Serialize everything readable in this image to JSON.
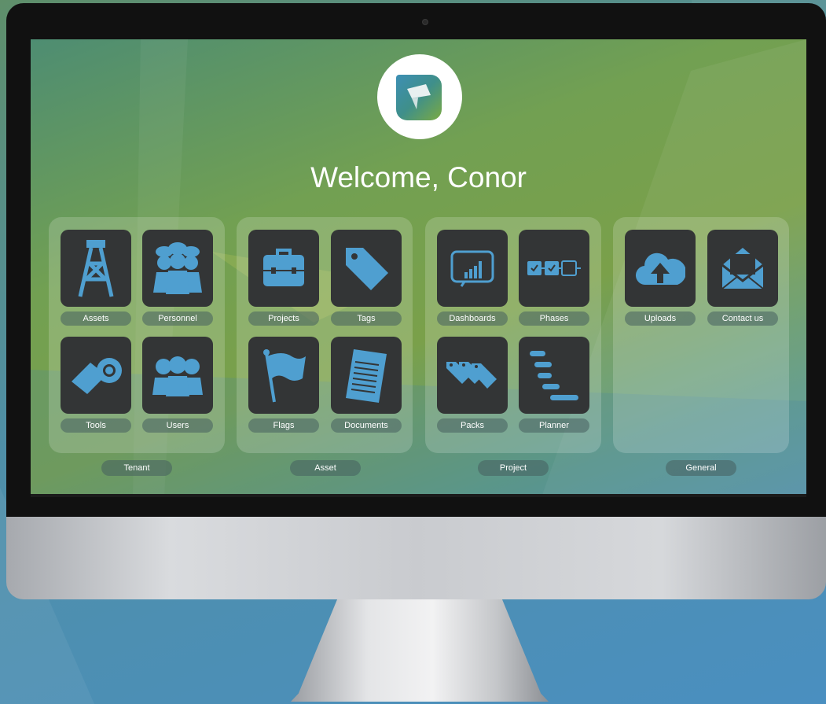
{
  "screen": {
    "welcome_text": "Welcome, Conor",
    "accent_color": "#4f9fd0",
    "tile_color": "#333536"
  },
  "groups": [
    {
      "label": "Tenant",
      "tiles": [
        {
          "label": "Assets",
          "icon": "oil-rig-icon"
        },
        {
          "label": "Personnel",
          "icon": "workers-icon"
        },
        {
          "label": "Tools",
          "icon": "pipe-tool-icon"
        },
        {
          "label": "Users",
          "icon": "users-icon"
        }
      ]
    },
    {
      "label": "Asset",
      "tiles": [
        {
          "label": "Projects",
          "icon": "briefcase-icon"
        },
        {
          "label": "Tags",
          "icon": "tag-icon"
        },
        {
          "label": "Flags",
          "icon": "flag-icon"
        },
        {
          "label": "Documents",
          "icon": "document-icon"
        }
      ]
    },
    {
      "label": "Project",
      "tiles": [
        {
          "label": "Dashboards",
          "icon": "dashboard-chart-icon"
        },
        {
          "label": "Phases",
          "icon": "phases-icon"
        },
        {
          "label": "Packs",
          "icon": "tags-pack-icon"
        },
        {
          "label": "Planner",
          "icon": "gantt-planner-icon"
        }
      ]
    },
    {
      "label": "General",
      "tiles": [
        {
          "label": "Uploads",
          "icon": "cloud-upload-icon"
        },
        {
          "label": "Contact us",
          "icon": "envelope-icon"
        }
      ]
    }
  ]
}
